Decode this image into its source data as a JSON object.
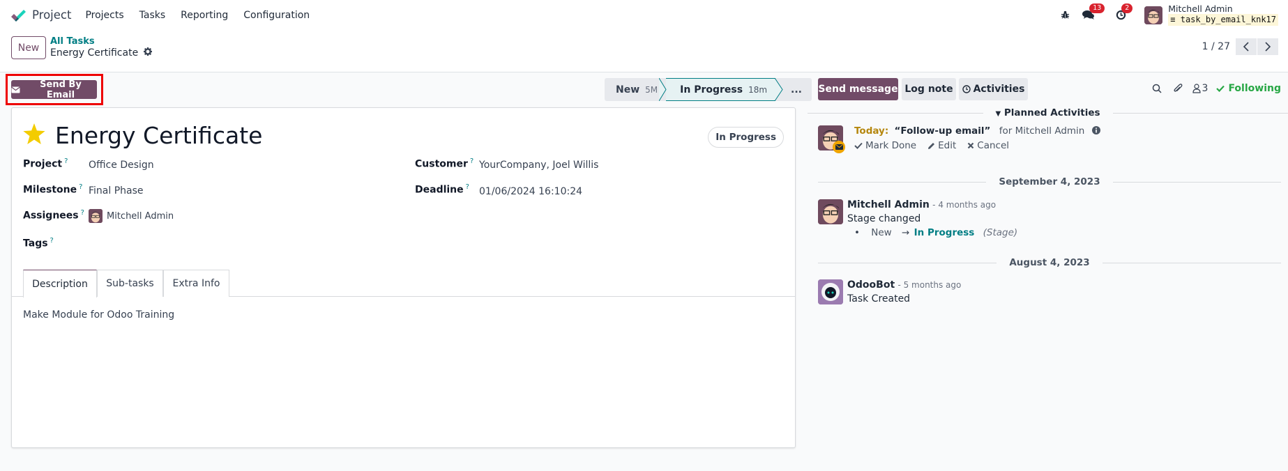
{
  "navbar": {
    "app_name": "Project",
    "menu": [
      "Projects",
      "Tasks",
      "Reporting",
      "Configuration"
    ],
    "icons": {
      "debug": "bug-icon",
      "messages": "chat-icon",
      "activities": "clock-icon"
    },
    "messages_count": "13",
    "activities_count": "2",
    "user_name": "Mitchell Admin",
    "database": "task_by_email_knk17"
  },
  "control_panel": {
    "new_label": "New",
    "breadcrumb_parent": "All Tasks",
    "breadcrumb_current": "Energy Certificate",
    "pager_value": "1 / 27"
  },
  "form": {
    "send_email_label": "Send By Email",
    "stages": [
      {
        "name": "New",
        "duration": "5M",
        "active": false
      },
      {
        "name": "In Progress",
        "duration": "18m",
        "active": true
      }
    ],
    "stages_more": "...",
    "title": "Energy Certificate",
    "starred": true,
    "state_pill": "In Progress",
    "help_marker": "?",
    "fields": {
      "project": {
        "label": "Project",
        "value": "Office Design"
      },
      "milestone": {
        "label": "Milestone",
        "value": "Final Phase"
      },
      "assignees": {
        "label": "Assignees",
        "value": "Mitchell Admin"
      },
      "tags": {
        "label": "Tags",
        "value": ""
      },
      "customer": {
        "label": "Customer",
        "value": "YourCompany, Joel Willis"
      },
      "deadline": {
        "label": "Deadline",
        "value": "01/06/2024 16:10:24"
      }
    },
    "tabs": [
      {
        "label": "Description",
        "active": true
      },
      {
        "label": "Sub-tasks",
        "active": false
      },
      {
        "label": "Extra Info",
        "active": false
      }
    ],
    "description": "Make Module for Odoo Training"
  },
  "chatter": {
    "send_message_label": "Send message",
    "log_note_label": "Log note",
    "activities_label": "Activities",
    "followers_count": "3",
    "following_label": "Following",
    "planned_activities_label": "Planned Activities",
    "activity": {
      "due": "Today:",
      "name": "“Follow-up email”",
      "for_text": "for Mitchell Admin",
      "mark_done": "Mark Done",
      "edit": "Edit",
      "cancel": "Cancel"
    },
    "groups": [
      {
        "date": "September 4, 2023",
        "messages": [
          {
            "author": "Mitchell Admin",
            "when": "- 4 months ago",
            "body": "Stage changed",
            "tracking": {
              "old": "New",
              "arrow": "→",
              "new": "In Progress",
              "field": "(Stage)"
            }
          }
        ]
      },
      {
        "date": "August 4, 2023",
        "messages": [
          {
            "author": "OdooBot",
            "when": "- 5 months ago",
            "body": "Task Created"
          }
        ]
      }
    ]
  },
  "colors": {
    "brand": "#714b67",
    "accent_teal": "#017e84",
    "following_green": "#28a745",
    "today_gold": "#b5870e",
    "star_yellow": "#f3cc00",
    "badge_red": "#d9232e",
    "highlight_red": "#ee0000"
  }
}
